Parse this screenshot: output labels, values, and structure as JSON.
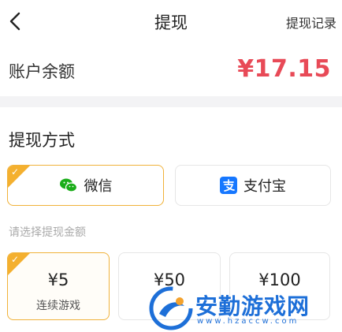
{
  "header": {
    "title": "提现",
    "record_link": "提现记录"
  },
  "balance": {
    "label": "账户余额",
    "value": "¥17.15"
  },
  "method_section": {
    "title": "提现方式",
    "methods": [
      {
        "label": "微信",
        "icon": "wechat-icon",
        "selected": true
      },
      {
        "label": "支付宝",
        "icon": "alipay-icon",
        "selected": false
      }
    ]
  },
  "amount_section": {
    "hint": "请选择提现金额",
    "options": [
      {
        "value": "¥5",
        "note": "连续游戏",
        "selected": true
      },
      {
        "value": "¥50",
        "note": "",
        "selected": false
      },
      {
        "value": "¥100",
        "note": "",
        "selected": false
      }
    ]
  },
  "watermark": {
    "text": "安勤游戏网",
    "url": "www.hzaccw.com"
  },
  "colors": {
    "accent": "#f4b02f",
    "balance": "#e84a57",
    "wechat": "#1aad19",
    "alipay": "#1677ff"
  }
}
